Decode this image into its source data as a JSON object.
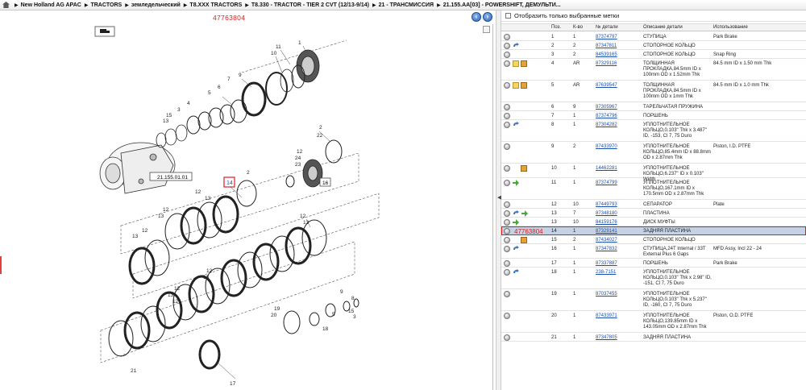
{
  "breadcrumb": {
    "items": [
      "New Holland AG APAC",
      "TRACTORS",
      "земледельческий",
      "T8.XXX TRACTORS",
      "T8.330 - TRACTOR - TIER 2 CVT (12/13-9/14)",
      "21 - ТРАНСМИССИЯ",
      "21.155.AA[03] - POWERSHIFT, ДЕМУЛЬТИ..."
    ]
  },
  "diagram": {
    "part_number": "47763804",
    "ref_label": "21.155.01.01",
    "selected_callout": "14",
    "callout_16": "16",
    "callouts": [
      "1",
      "11",
      "10",
      "9",
      "7",
      "6",
      "5",
      "4",
      "3",
      "2",
      "15",
      "13",
      "12",
      "13",
      "12",
      "13",
      "12",
      "13",
      "12",
      "13",
      "12",
      "13",
      "12",
      "24",
      "23",
      "22",
      "2",
      "12",
      "13",
      "12",
      "13",
      "21",
      "19",
      "20",
      "18",
      "17",
      "9",
      "8",
      "5",
      "3",
      "15",
      "14"
    ]
  },
  "filter": {
    "label": "Отобразить только выбранные метки"
  },
  "table": {
    "columns": [
      "Поз.",
      "К-во",
      "№ детали",
      "Описание детали",
      "Использование"
    ],
    "rows": [
      {
        "pos": "1",
        "qty": "1",
        "num": "87374797",
        "desc": "СТУПИЦА",
        "use": "Park Brake",
        "icons": [
          "info"
        ]
      },
      {
        "pos": "2",
        "qty": "2",
        "num": "87347811",
        "desc": "СТОПОРНОЕ КОЛЬЦО",
        "use": "",
        "icons": [
          "info",
          "swap"
        ]
      },
      {
        "pos": "3",
        "qty": "2",
        "num": "84539165",
        "desc": "СТОПОРНОЕ КОЛЬЦО",
        "use": "Snap Ring",
        "icons": [
          "info"
        ]
      },
      {
        "pos": "4",
        "qty": "AR",
        "num": "87329116",
        "desc": "ТОЛЩИННАЯ ПРОКЛАДКА,84.5mm ID x 100mm OD x 1.52mm Thk",
        "use": "84.5 mm ID x 1.50 mm Thk",
        "icons": [
          "info",
          "note",
          "box"
        ]
      },
      {
        "pos": "5",
        "qty": "AR",
        "num": "87639547",
        "desc": "ТОЛЩИННАЯ ПРОКЛАДКА,84.5mm ID x 100mm OD x 1mm Thk",
        "use": "84.5 mm ID x 1.0 mm Thk",
        "icons": [
          "info",
          "note",
          "box"
        ]
      },
      {
        "pos": "6",
        "qty": "9",
        "num": "87305967",
        "desc": "ТАРЕЛЬЧАТАЯ ПРУЖИНА",
        "use": "",
        "icons": [
          "info"
        ]
      },
      {
        "pos": "7",
        "qty": "1",
        "num": "87374796",
        "desc": "ПОРШЕНЬ",
        "use": "",
        "icons": [
          "info"
        ]
      },
      {
        "pos": "8",
        "qty": "1",
        "num": "87304282",
        "desc": "УПЛОТНИТЕЛЬНОЕ КОЛЬЦО,0.103\" Thk x 3.487\" ID, -153, Cl 7, 75 Duro",
        "use": "",
        "icons": [
          "info",
          "swap"
        ]
      },
      {
        "pos": "9",
        "qty": "2",
        "num": "87433970",
        "desc": "УПЛОТНИТЕЛЬНОЕ КОЛЬЦО,85.4mm ID x 88.8mm OD x 2.87mm Thk",
        "use": "Piston, I.D. PTFE",
        "icons": [
          "info"
        ]
      },
      {
        "pos": "10",
        "qty": "1",
        "num": "14462281",
        "desc": "УПЛОТНИТЕЛЬНОЕ КОЛЬЦО,6.237\" ID x 0.103\" Width",
        "use": "",
        "icons": [
          "info",
          "box"
        ]
      },
      {
        "pos": "11",
        "qty": "1",
        "num": "87374799",
        "desc": "УПЛОТНИТЕЛЬНОЕ КОЛЬЦО,167.1mm ID x 170.5mm OD x 2.87mm Thk",
        "use": "",
        "icons": [
          "info",
          "green"
        ]
      },
      {
        "pos": "12",
        "qty": "10",
        "num": "87449793",
        "desc": "СЕПАРАТОР",
        "use": "Plate",
        "icons": [
          "info"
        ]
      },
      {
        "pos": "13",
        "qty": "7",
        "num": "87348180",
        "desc": "ПЛАСТИНА",
        "use": "",
        "icons": [
          "info",
          "swap",
          "green"
        ]
      },
      {
        "pos": "13",
        "qty": "10",
        "num": "84159176",
        "desc": "ДИСК МУФТЫ",
        "use": "",
        "icons": [
          "info",
          "green"
        ]
      },
      {
        "pos": "14",
        "qty": "1",
        "num": "87329141",
        "desc": "ЗАДНЯЯ ПЛАСТИНА",
        "use": "",
        "icons": [
          "info"
        ],
        "selected": true,
        "sel_part": "47763804"
      },
      {
        "pos": "15",
        "qty": "2",
        "num": "87434027",
        "desc": "СТОПОРНОЕ КОЛЬЦО",
        "use": "",
        "icons": [
          "info",
          "box"
        ]
      },
      {
        "pos": "16",
        "qty": "1",
        "num": "87347832",
        "desc": "СТУПИЦА,24T Internal / 33T External Plus 6 Gaps",
        "use": "MFD Assy, Incl 22 - 24",
        "icons": [
          "info",
          "swap"
        ]
      },
      {
        "pos": "17",
        "qty": "1",
        "num": "87337887",
        "desc": "ПОРШЕНЬ",
        "use": "Park Brake",
        "icons": [
          "info"
        ]
      },
      {
        "pos": "18",
        "qty": "1",
        "num": "238-7151",
        "desc": "УПЛОТНИТЕЛЬНОЕ КОЛЬЦО,0.103\" Thk x 2.98\" ID, -151, Cl 7, 75 Duro",
        "use": "",
        "icons": [
          "info",
          "swap"
        ]
      },
      {
        "pos": "19",
        "qty": "1",
        "num": "87037455",
        "desc": "УПЛОТНИТЕЛЬНОЕ КОЛЬЦО,0.103\" Thk x 5.237\" ID, -160, Cl 7, 75 Duro",
        "use": "",
        "icons": [
          "info"
        ]
      },
      {
        "pos": "20",
        "qty": "1",
        "num": "87433971",
        "desc": "УПЛОТНИТЕЛЬНОЕ КОЛЬЦО,139.85mm ID x 143.05mm OD x 2.87mm Thk",
        "use": "Piston, O.D. PTFE",
        "icons": [
          "info"
        ]
      },
      {
        "pos": "21",
        "qty": "1",
        "num": "87347805",
        "desc": "ЗАДНЯЯ ПЛАСТИНА",
        "use": "",
        "icons": [
          "info"
        ]
      }
    ]
  }
}
